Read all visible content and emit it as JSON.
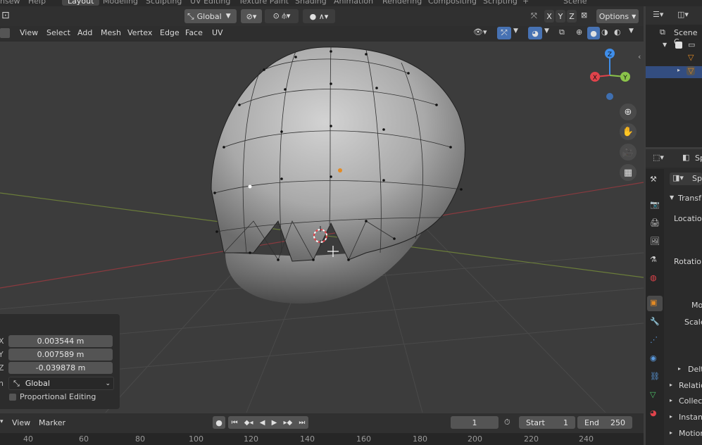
{
  "workspaces": [
    "nsew",
    "Help",
    "Layout",
    "Modeling",
    "Sculpting",
    "UV Editing",
    "Texture Paint",
    "Shading",
    "Animation",
    "Rendering",
    "Compositing",
    "Scripting"
  ],
  "scene_label": "Scene",
  "header": {
    "orientation": "Global",
    "options": "Options",
    "axes": [
      "X",
      "Y",
      "Z"
    ]
  },
  "viewport_menu": [
    "View",
    "Select",
    "Add",
    "Mesh",
    "Vertex",
    "Edge",
    "Face",
    "UV"
  ],
  "last_op_panel": {
    "x_label": "X",
    "y_label": "Y",
    "z_label": "Z",
    "x": "0.003544 m",
    "y": "0.007589 m",
    "z": "-0.039878 m",
    "orient_prefix": "n",
    "orient": "Global",
    "proportional": "Proportional Editing"
  },
  "gizmo": {
    "x": "X",
    "y": "Y",
    "z": "Z"
  },
  "outliner": {
    "title": "Scene C"
  },
  "properties": {
    "tab_label": "Sp",
    "section": "Transf",
    "fields": [
      "Location",
      "Rotation",
      "Mo",
      "Scale"
    ],
    "subsections": [
      "Delt",
      "Relatio",
      "Collec",
      "Instan",
      "Motion"
    ]
  },
  "timeline": {
    "menu": [
      "View",
      "Marker"
    ],
    "current_frame": "1",
    "start_label": "Start",
    "start": "1",
    "end_label": "End",
    "end": "250",
    "ruler": [
      "40",
      "60",
      "80",
      "100",
      "120",
      "140",
      "160",
      "180",
      "200",
      "220",
      "240"
    ]
  },
  "colors": {
    "accent": "#4772b3",
    "object_orange": "#e48b24",
    "axis_x": "#e0434b",
    "axis_y": "#8bc34a",
    "axis_z": "#3f8eea"
  }
}
